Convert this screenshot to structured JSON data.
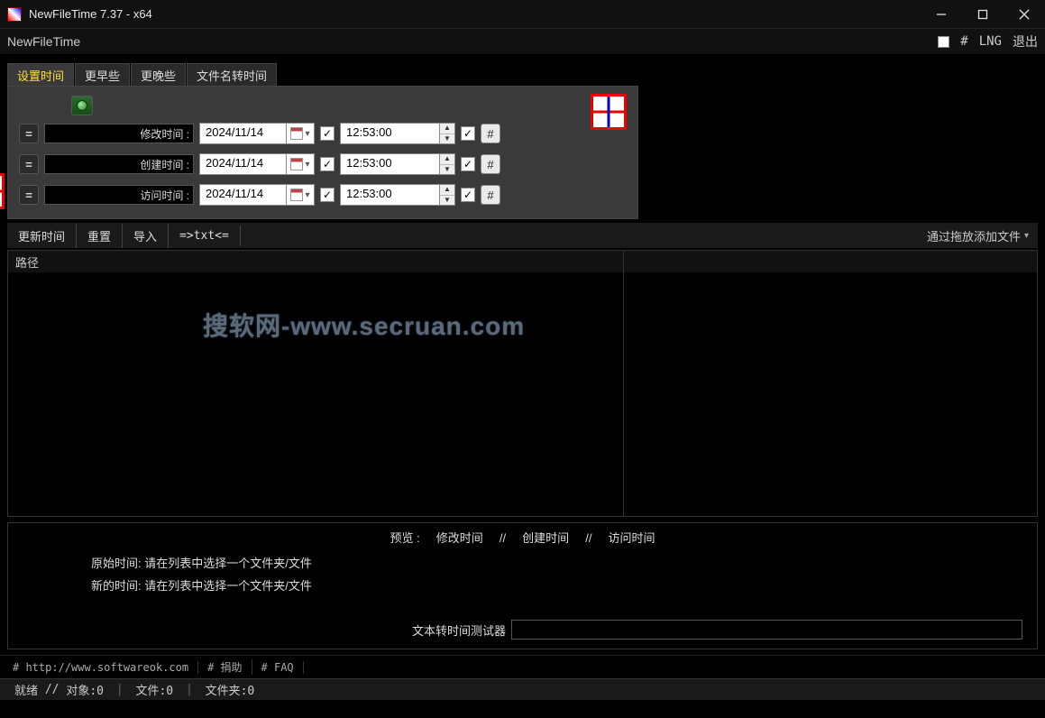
{
  "titlebar": {
    "title": "NewFileTime 7.37 - x64"
  },
  "menubar": {
    "app": "NewFileTime",
    "hash": "#",
    "lng": "LNG",
    "exit": "退出"
  },
  "tabs": {
    "set_time": "设置时间",
    "earlier": "更早些",
    "later": "更晚些",
    "name_to_time": "文件名转时间"
  },
  "rows": {
    "mod": {
      "label": "修改时间 :",
      "date": "2024/11/14",
      "time": "12:53:00"
    },
    "create": {
      "label": "创建时间 :",
      "date": "2024/11/14",
      "time": "12:53:00"
    },
    "access": {
      "label": "访问时间 :",
      "date": "2024/11/14",
      "time": "12:53:00"
    },
    "eq": "=",
    "hash": "#",
    "check": "✓"
  },
  "toolbar": {
    "update": "更新时间",
    "reset": "重置",
    "import": "导入",
    "txt": "=>txt<=",
    "drag_hint": "通过拖放添加文件"
  },
  "filelist": {
    "path_header": "路径",
    "watermark": "搜软网-www.secruan.com"
  },
  "preview": {
    "header_prefix": "预览   :",
    "mod": "修改时间",
    "create": "创建时间",
    "access": "访问时间",
    "sep": "//",
    "orig_label": "原始时间:",
    "new_label": "新的时间:",
    "placeholder": "请在列表中选择一个文件夹/文件",
    "tester_label": "文本转时间测试器"
  },
  "links": {
    "site": "# http://www.softwareok.com",
    "donate": "# 捐助",
    "faq": "# FAQ"
  },
  "status": {
    "ready": "就绪",
    "sep": "//",
    "objects": "对象:0",
    "files": "文件:0",
    "folders": "文件夹:0",
    "divider": "|"
  }
}
